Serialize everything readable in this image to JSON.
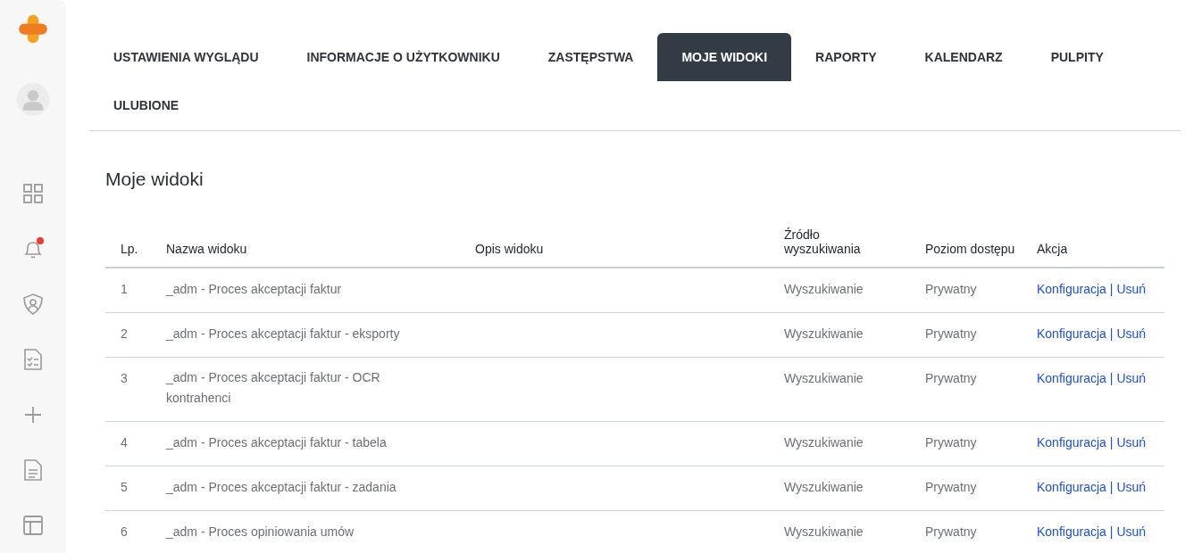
{
  "sidebar": {
    "items": [
      {
        "kind": "grid",
        "badge": false
      },
      {
        "kind": "bell",
        "badge": true
      },
      {
        "kind": "shield",
        "badge": false
      },
      {
        "kind": "checklist",
        "badge": false
      },
      {
        "kind": "plus",
        "badge": false
      },
      {
        "kind": "document",
        "badge": false
      },
      {
        "kind": "layout",
        "badge": false
      }
    ]
  },
  "tabs": [
    {
      "label": "USTAWIENIA WYGLĄDU",
      "selected": false
    },
    {
      "label": "INFORMACJE O UŻYTKOWNIKU",
      "selected": false
    },
    {
      "label": "ZASTĘPSTWA",
      "selected": false
    },
    {
      "label": "MOJE WIDOKI",
      "selected": true
    },
    {
      "label": "RAPORTY",
      "selected": false
    },
    {
      "label": "KALENDARZ",
      "selected": false
    },
    {
      "label": "PULPITY",
      "selected": false
    },
    {
      "label": "ULUBIONE",
      "selected": false
    }
  ],
  "heading": "Moje widoki",
  "table": {
    "columns": [
      "Lp.",
      "Nazwa widoku",
      "Opis widoku",
      "Źródło wyszukiwania",
      "Poziom dostępu",
      "Akcja"
    ],
    "rows": [
      {
        "lp": "1",
        "name": "_adm - Proces akceptacji faktur",
        "source": "Wyszukiwanie",
        "access": "Prywatny",
        "actions": [
          "Konfiguracja",
          "|",
          "Usuń"
        ]
      },
      {
        "lp": "2",
        "name": "_adm - Proces akceptacji faktur - eksporty",
        "source": "Wyszukiwanie",
        "access": "Prywatny",
        "actions": [
          "Konfiguracja",
          "|",
          "Usuń"
        ]
      },
      {
        "lp": "3",
        "name": "_adm - Proces akceptacji faktur - OCR kontrahenci",
        "source": "Wyszukiwanie",
        "access": "Prywatny",
        "actions": [
          "Konfiguracja",
          "|",
          "Usuń"
        ]
      },
      {
        "lp": "4",
        "name": "_adm - Proces akceptacji faktur - tabela",
        "source": "Wyszukiwanie",
        "access": "Prywatny",
        "actions": [
          "Konfiguracja",
          "|",
          "Usuń"
        ]
      },
      {
        "lp": "5",
        "name": "_adm - Proces akceptacji faktur - zadania",
        "source": "Wyszukiwanie",
        "access": "Prywatny",
        "actions": [
          "Konfiguracja",
          "|",
          "Usuń"
        ]
      },
      {
        "lp": "6",
        "name": "_adm - Proces opiniowania umów",
        "source": "Wyszukiwanie",
        "access": "Prywatny",
        "actions": [
          "Konfiguracja",
          "|",
          "Usuń"
        ]
      }
    ]
  }
}
